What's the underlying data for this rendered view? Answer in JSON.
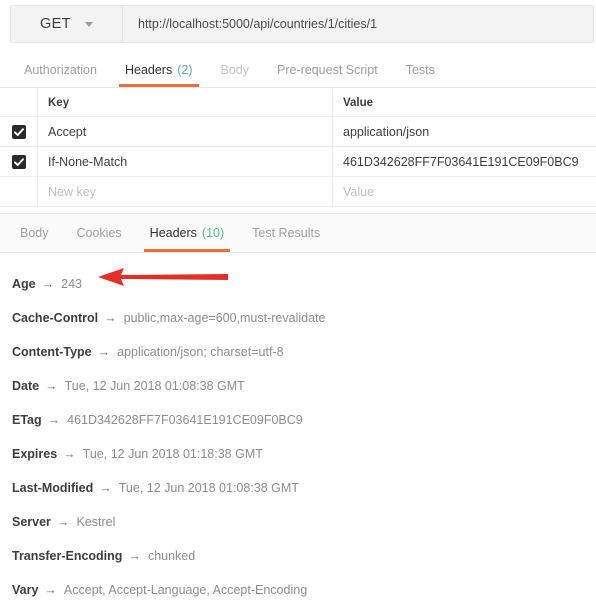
{
  "request": {
    "method": "GET",
    "url": "http://localhost:5000/api/countries/1/cities/1",
    "tabs": [
      {
        "label": "Authorization",
        "count": "",
        "state": "inactive"
      },
      {
        "label": "Headers",
        "count": "(2)",
        "state": "active"
      },
      {
        "label": "Body",
        "count": "",
        "state": "disabled"
      },
      {
        "label": "Pre-request Script",
        "count": "",
        "state": "inactive"
      },
      {
        "label": "Tests",
        "count": "",
        "state": "inactive"
      }
    ],
    "headers_table": {
      "columns": {
        "key": "Key",
        "value": "Value"
      },
      "rows": [
        {
          "checked": true,
          "key": "Accept",
          "value": "application/json"
        },
        {
          "checked": true,
          "key": "If-None-Match",
          "value": "461D342628FF7F03641E191CE09F0BC9"
        }
      ],
      "new_row": {
        "key_placeholder": "New key",
        "value_placeholder": "Value"
      }
    }
  },
  "response": {
    "tabs": [
      {
        "label": "Body",
        "count": "",
        "state": "inactive"
      },
      {
        "label": "Cookies",
        "count": "",
        "state": "inactive"
      },
      {
        "label": "Headers",
        "count": "(10)",
        "state": "active"
      },
      {
        "label": "Test Results",
        "count": "",
        "state": "inactive"
      }
    ],
    "arrow_symbol": "→",
    "headers": [
      {
        "name": "Age",
        "value": "243"
      },
      {
        "name": "Cache-Control",
        "value": "public,max-age=600,must-revalidate"
      },
      {
        "name": "Content-Type",
        "value": "application/json; charset=utf-8"
      },
      {
        "name": "Date",
        "value": "Tue, 12 Jun 2018 01:08:38 GMT"
      },
      {
        "name": "ETag",
        "value": "461D342628FF7F03641E191CE09F0BC9"
      },
      {
        "name": "Expires",
        "value": "Tue, 12 Jun 2018 01:18:38 GMT"
      },
      {
        "name": "Last-Modified",
        "value": "Tue, 12 Jun 2018 01:08:38 GMT"
      },
      {
        "name": "Server",
        "value": "Kestrel"
      },
      {
        "name": "Transfer-Encoding",
        "value": "chunked"
      },
      {
        "name": "Vary",
        "value": "Accept, Accept-Language, Accept-Encoding"
      }
    ]
  },
  "annotation": {
    "type": "arrow",
    "points_to": "Age header row",
    "color": "#e03127"
  },
  "colors": {
    "accent_underline": "#e8703a",
    "count_green": "#5fb08c",
    "checkbox": "#2b2b2b",
    "annotation_red": "#e03127"
  }
}
